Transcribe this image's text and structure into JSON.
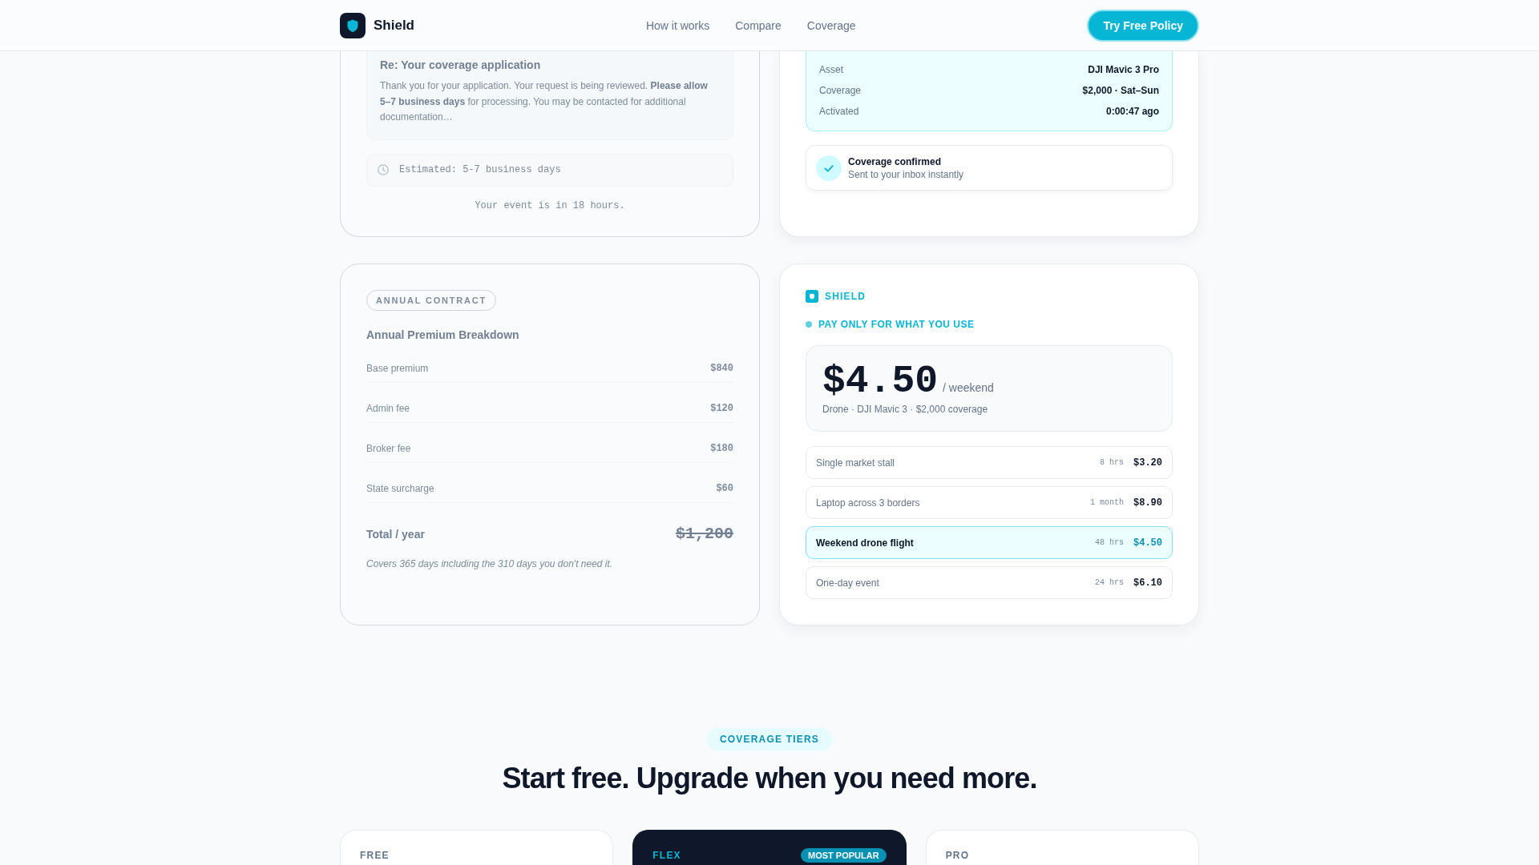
{
  "header": {
    "brand": "Shield",
    "nav": [
      {
        "label": "How it works"
      },
      {
        "label": "Compare"
      },
      {
        "label": "Coverage"
      }
    ],
    "cta": "Try Free Policy"
  },
  "application_card": {
    "email": {
      "subject": "Re: Your coverage application",
      "body": "Thank you for your application. Your request is being reviewed. **Please allow 5–7 business days** for processing. You may be contacted for additional documentation…"
    },
    "estimate": "Estimated: 5-7 business days",
    "note": "Your event is in 18 hours."
  },
  "policy_card": {
    "details": [
      {
        "label": "Asset",
        "value": "DJI Mavic 3 Pro"
      },
      {
        "label": "Coverage",
        "value": "$2,000 · Sat–Sun"
      },
      {
        "label": "Activated",
        "value": "0:00:47 ago"
      }
    ],
    "confirmation": {
      "title": "Coverage confirmed",
      "subtitle": "Sent to your inbox instantly"
    }
  },
  "annual_contract": {
    "tag": "ANNUAL CONTRACT",
    "title": "Annual Premium Breakdown",
    "lines": [
      {
        "label": "Base premium",
        "amount": "$840"
      },
      {
        "label": "Admin fee",
        "amount": "$120"
      },
      {
        "label": "Broker fee",
        "amount": "$180"
      },
      {
        "label": "State surcharge",
        "amount": "$60"
      }
    ],
    "total": {
      "label": "Total / year",
      "amount": "$1,200",
      "struck": true
    },
    "footnote": "Covers 365 days including the 310 days you don't need it."
  },
  "shield_pricing": {
    "brand": "SHIELD",
    "tagline": "PAY ONLY FOR WHAT YOU USE",
    "price": "$4.50",
    "period": "/ weekend",
    "summary": "Drone · DJI Mavic 3 · $2,000 coverage",
    "options": [
      {
        "label": "Single market stall",
        "duration": "8 hrs",
        "price": "$3.20",
        "selected": false
      },
      {
        "label": "Laptop across 3 borders",
        "duration": "1 month",
        "price": "$8.90",
        "selected": false
      },
      {
        "label": "Weekend drone flight",
        "duration": "48 hrs",
        "price": "$4.50",
        "selected": true
      },
      {
        "label": "One-day event",
        "duration": "24 hrs",
        "price": "$6.10",
        "selected": false
      }
    ]
  },
  "tiers_section": {
    "eyebrow": "COVERAGE TIERS",
    "heading": "Start free. Upgrade when you need more.",
    "tiers": [
      {
        "name": "FREE",
        "featured": false
      },
      {
        "name": "FLEX",
        "featured": true,
        "badge": "MOST POPULAR"
      },
      {
        "name": "PRO",
        "featured": false
      }
    ]
  }
}
